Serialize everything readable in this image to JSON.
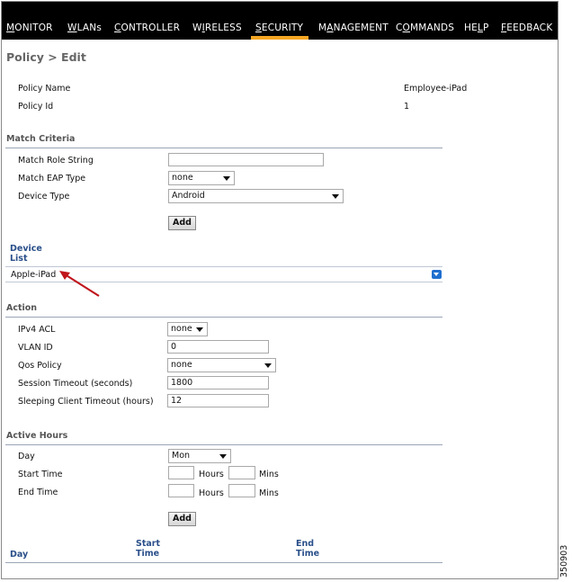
{
  "nav": {
    "items": [
      {
        "pre": "",
        "ul": "M",
        "post": "ONITOR"
      },
      {
        "pre": "",
        "ul": "W",
        "post": "LANs"
      },
      {
        "pre": "",
        "ul": "C",
        "post": "ONTROLLER"
      },
      {
        "pre": "W",
        "ul": "I",
        "post": "RELESS"
      },
      {
        "pre": "",
        "ul": "S",
        "post": "ECURITY"
      },
      {
        "pre": "M",
        "ul": "A",
        "post": "NAGEMENT"
      },
      {
        "pre": "C",
        "ul": "O",
        "post": "MMANDS"
      },
      {
        "pre": "HE",
        "ul": "L",
        "post": "P"
      },
      {
        "pre": "",
        "ul": "F",
        "post": "EEDBACK"
      }
    ],
    "active": "SECURITY",
    "active_color": "#f5a623"
  },
  "page_title": "Policy > Edit",
  "policy": {
    "name_label": "Policy Name",
    "name_value": "Employee-iPad",
    "id_label": "Policy Id",
    "id_value": "1"
  },
  "match": {
    "section": "Match Criteria",
    "role_label": "Match Role String",
    "role_value": "",
    "eap_label": "Match EAP Type",
    "eap_value": "none",
    "device_label": "Device Type",
    "device_value": "Android",
    "add_label": "Add"
  },
  "device_list": {
    "header_line1": "Device",
    "header_line2": "List",
    "items": [
      "Apple-iPad"
    ],
    "arrow_color": "#c0161c"
  },
  "action": {
    "section": "Action",
    "acl_label": "IPv4 ACL",
    "acl_value": "none",
    "vlan_label": "VLAN ID",
    "vlan_value": "0",
    "qos_label": "Qos Policy",
    "qos_value": "none",
    "session_label": "Session Timeout (seconds)",
    "session_value": "1800",
    "sleep_label": "Sleeping Client Timeout (hours)",
    "sleep_value": "12"
  },
  "active_hours": {
    "section": "Active Hours",
    "day_label": "Day",
    "day_value": "Mon",
    "start_label": "Start Time",
    "end_label": "End Time",
    "hours_label": "Hours",
    "mins_label": "Mins",
    "start_hours": "",
    "start_mins": "",
    "end_hours": "",
    "end_mins": "",
    "add_label": "Add",
    "table_headers": {
      "day": "Day",
      "start_line1": "Start",
      "start_line2": "Time",
      "end_line1": "End",
      "end_line2": "Time"
    }
  },
  "figure_number": "350903"
}
